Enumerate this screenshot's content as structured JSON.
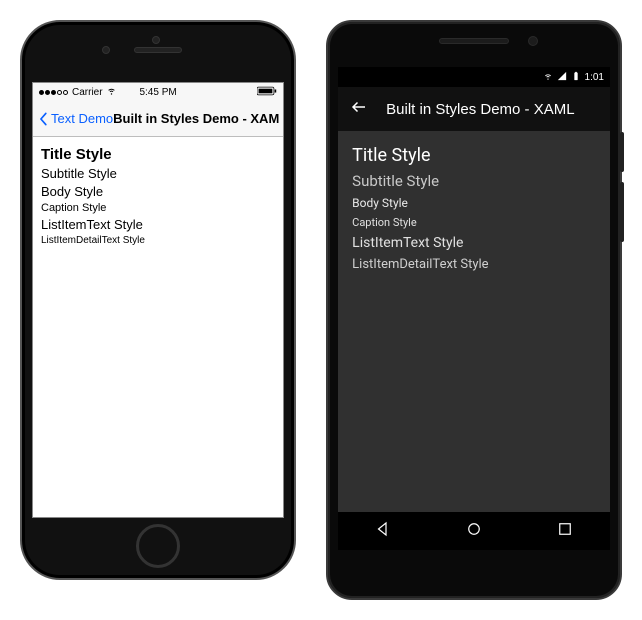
{
  "ios": {
    "statusbar": {
      "carrier_label": "Carrier",
      "time": "5:45 PM"
    },
    "nav": {
      "back_label": "Text Demo",
      "title": "Built in Styles Demo - XAML"
    },
    "styles": {
      "title": "Title Style",
      "subtitle": "Subtitle Style",
      "body": "Body Style",
      "caption": "Caption Style",
      "listitem": "ListItemText Style",
      "listdetail": "ListItemDetailText Style"
    }
  },
  "android": {
    "statusbar": {
      "time": "1:01"
    },
    "appbar": {
      "title": "Built in Styles Demo - XAML"
    },
    "styles": {
      "title": "Title Style",
      "subtitle": "Subtitle Style",
      "body": "Body Style",
      "caption": "Caption Style",
      "listitem": "ListItemText Style",
      "listdetail": "ListItemDetailText Style"
    }
  }
}
